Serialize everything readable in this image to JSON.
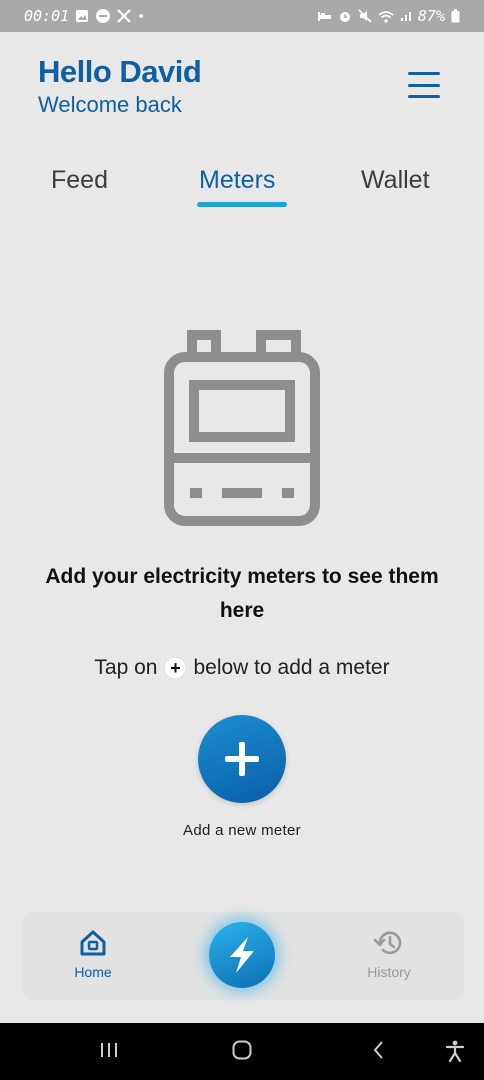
{
  "status_bar": {
    "time": "00:01",
    "battery": "87%",
    "left_icons": [
      "gallery-icon",
      "do-not-disturb-icon",
      "x-app-icon",
      "dot-icon"
    ],
    "right_icons": [
      "bed-icon",
      "alarm-icon",
      "mute-icon",
      "wifi-icon",
      "signal-icon",
      "battery-icon"
    ]
  },
  "header": {
    "greeting": "Hello David",
    "subtitle": "Welcome back",
    "menu_icon": "hamburger-menu-icon"
  },
  "tabs": [
    {
      "label": "Feed",
      "active": false
    },
    {
      "label": "Meters",
      "active": true
    },
    {
      "label": "Wallet",
      "active": false
    }
  ],
  "empty_state": {
    "illustration_icon": "electricity-meter-icon",
    "title": "Add your electricity meters to see them here",
    "hint_before": "Tap on",
    "hint_after": "below to add a meter",
    "add_button_icon": "plus-icon",
    "add_label": "Add a new meter"
  },
  "bottom_nav": {
    "home_label": "Home",
    "history_label": "History",
    "center_icon": "lightning-bolt-icon"
  },
  "colors": {
    "brand_blue": "#0e5fa4",
    "accent_cyan": "#1fa3d6",
    "background": "#e8e8e8",
    "inactive_gray": "#9a9a9a"
  }
}
